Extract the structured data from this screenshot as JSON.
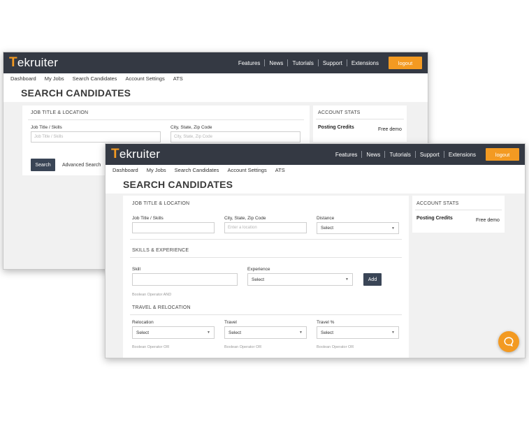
{
  "brand": {
    "logo_first": "T",
    "logo_rest": "ekruiter",
    "accent": "#f39a22",
    "nav_bg": "#343943"
  },
  "nav": {
    "items": [
      "Features",
      "News",
      "Tutorials",
      "Support",
      "Extensions"
    ],
    "logout": "logout"
  },
  "subnav": [
    "Dashboard",
    "My Jobs",
    "Search Candidates",
    "Account Settings",
    "ATS"
  ],
  "page_title": "SEARCH CANDIDATES",
  "back": {
    "section_title": "JOB TITLE & LOCATION",
    "job_label": "Job Title / Skills",
    "job_placeholder": "Job Title / Skills",
    "city_label": "City, State, Zip Code",
    "city_placeholder": "City, State, Zip Code",
    "search_button": "Search",
    "advanced_search": "Advanced Search",
    "stats_title": "ACCOUNT STATS",
    "posting_credits_label": "Posting Credits",
    "posting_credits_value": "Free demo"
  },
  "front": {
    "section1_title": "JOB TITLE & LOCATION",
    "job_label": "Job Title / Skills",
    "job_value": "",
    "city_label": "City, State, Zip Code",
    "city_placeholder": "Enter a location",
    "distance_label": "Distance",
    "distance_value": "Select",
    "section2_title": "SKILLS & EXPERIENCE",
    "skill_label": "Skill",
    "skill_value": "",
    "experience_label": "Experience",
    "experience_value": "Select",
    "add_button": "Add",
    "skill_hint": "Boolean Operator AND",
    "section3_title": "TRAVEL & RELOCATION",
    "relocation_label": "Relocation",
    "relocation_value": "Select",
    "travel_label": "Travel",
    "travel_value": "Select",
    "travel_pct_label": "Travel %",
    "travel_pct_value": "Select",
    "or_hint": "Boolean Operator OR",
    "stats_title": "ACCOUNT STATS",
    "posting_credits_label": "Posting Credits",
    "posting_credits_value": "Free demo"
  },
  "icons": {
    "caret": "caret-down-icon",
    "chat": "chat-bubble-icon"
  }
}
